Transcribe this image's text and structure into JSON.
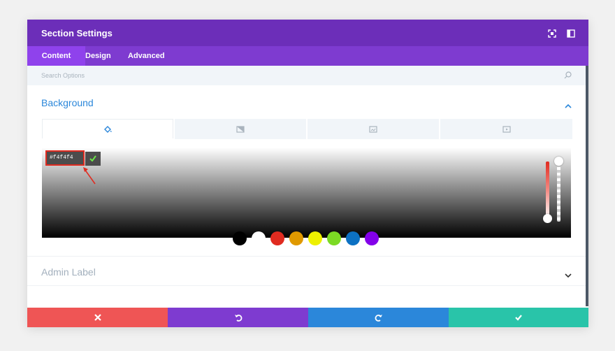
{
  "header": {
    "title": "Section Settings",
    "icons": [
      "fullscreen-icon",
      "sidebar-icon"
    ],
    "color": "#6c2eb9"
  },
  "tabs": [
    {
      "label": "Content",
      "active": true
    },
    {
      "label": "Design",
      "active": false
    },
    {
      "label": "Advanced",
      "active": false
    }
  ],
  "search": {
    "placeholder": "Search Options",
    "icon": "search-icon"
  },
  "background_section": {
    "title": "Background",
    "expanded": true,
    "bg_tabs": [
      "paint-bucket-icon",
      "gradient-icon",
      "image-icon",
      "video-icon"
    ],
    "active_bg_tab": 0,
    "color_picker": {
      "hex_value": "#f4f4f4",
      "swatches": [
        "#000000",
        "#ffffff",
        "#e02b20",
        "#e09900",
        "#edf000",
        "#7cda24",
        "#0c71c3",
        "#8300e9"
      ]
    }
  },
  "admin_label_section": {
    "title": "Admin Label",
    "expanded": false
  },
  "footer": {
    "buttons": [
      {
        "name": "cancel",
        "icon": "close-icon",
        "color": "#ef5555"
      },
      {
        "name": "undo",
        "icon": "undo-icon",
        "color": "#7e3bd0"
      },
      {
        "name": "redo",
        "icon": "redo-icon",
        "color": "#2b87da"
      },
      {
        "name": "save",
        "icon": "checkmark-icon",
        "color": "#29c4a9"
      }
    ]
  },
  "colors": {
    "accent_blue": "#2b87da",
    "highlight_red": "#e02b20"
  }
}
